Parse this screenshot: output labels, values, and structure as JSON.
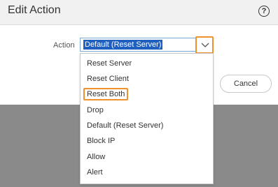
{
  "dialog": {
    "title": "Edit Action",
    "help_icon": "?"
  },
  "form": {
    "action_label": "Action",
    "action_value": "Default (Reset Server)"
  },
  "buttons": {
    "cancel_label": "Cancel"
  },
  "dropdown": {
    "options": [
      {
        "label": "Reset Server"
      },
      {
        "label": "Reset Client"
      },
      {
        "label": "Reset Both",
        "highlighted": true
      },
      {
        "label": "Drop"
      },
      {
        "label": "Default (Reset Server)"
      },
      {
        "label": "Block IP"
      },
      {
        "label": "Allow"
      },
      {
        "label": "Alert"
      }
    ]
  },
  "colors": {
    "highlight": "#f0922c",
    "selection": "#1f5fbf",
    "backdrop": "#8a8a8a"
  }
}
